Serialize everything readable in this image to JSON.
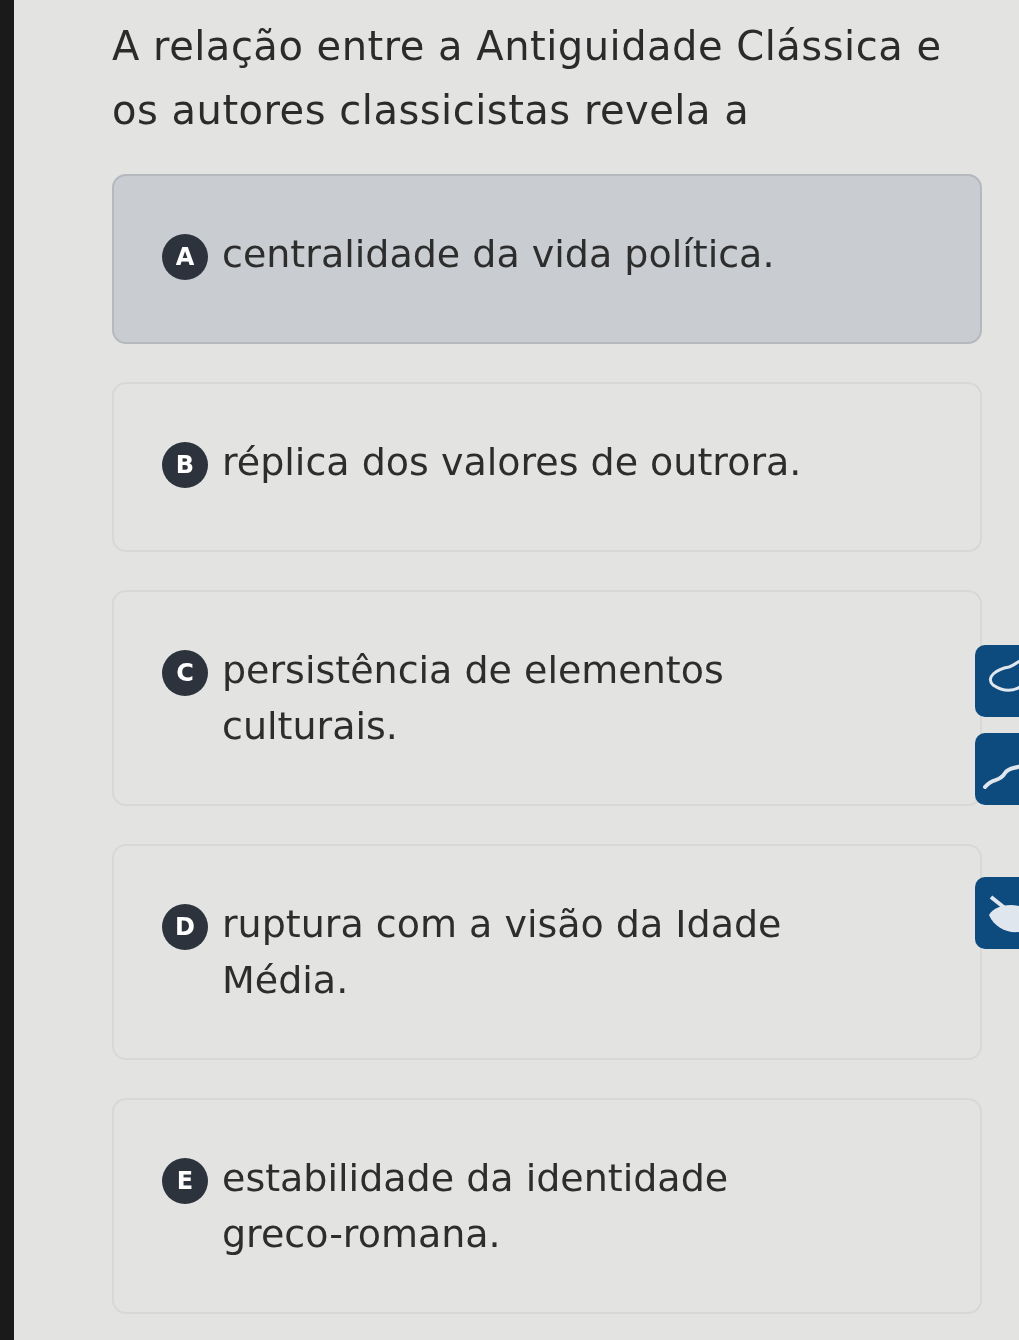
{
  "question": "A relação entre a Antiguidade Clássica e os autores classicistas revela a",
  "options": [
    {
      "letter": "A",
      "text": "centralidade da vida política.",
      "selected": true
    },
    {
      "letter": "B",
      "text": "réplica dos valores de outrora.",
      "selected": false
    },
    {
      "letter": "C",
      "text": "persistência de elementos culturais.",
      "selected": false
    },
    {
      "letter": "D",
      "text": "ruptura com a visão da Idade Média.",
      "selected": false
    },
    {
      "letter": "E",
      "text": "estabilidade da identidade greco-romana.",
      "selected": false
    }
  ],
  "tools": [
    {
      "kind": "highlighter"
    },
    {
      "kind": "pen"
    },
    {
      "kind": "eraser"
    }
  ]
}
